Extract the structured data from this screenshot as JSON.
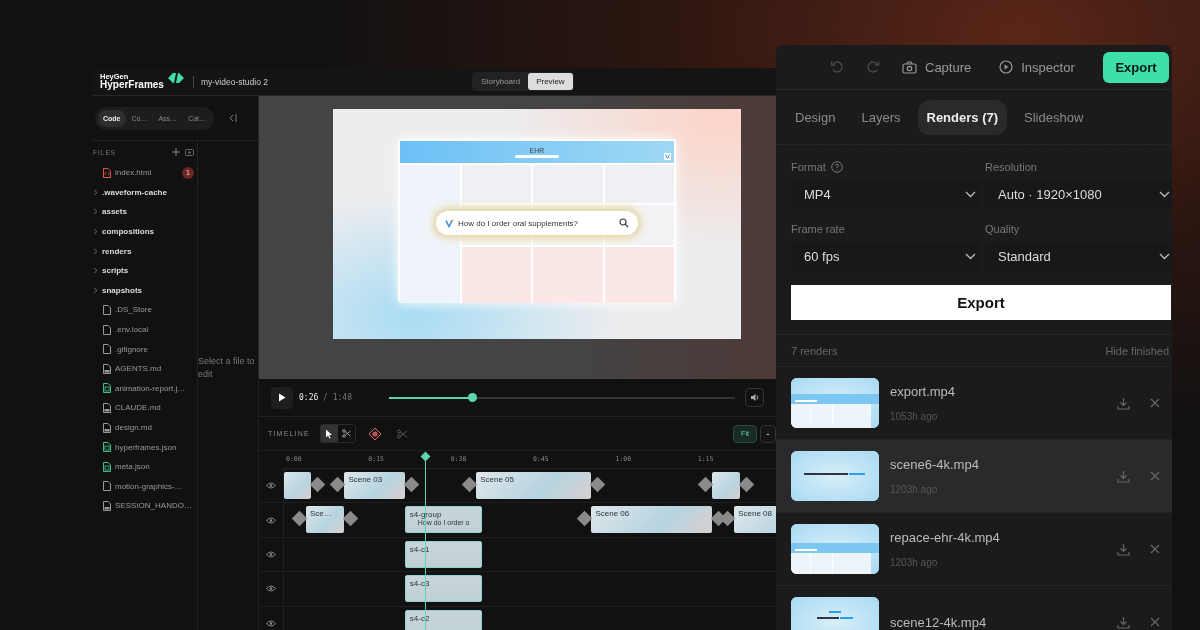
{
  "app": {
    "logo_top": "HeyGen",
    "logo_bottom": "HyperFrames",
    "project": "my-video-studio 2"
  },
  "view_switch": [
    {
      "label": "Storyboard",
      "selected": false
    },
    {
      "label": "Preview",
      "selected": true
    }
  ],
  "sidebar": {
    "tabs": [
      {
        "label": "Code",
        "selected": true
      },
      {
        "label": "Co…",
        "selected": false
      },
      {
        "label": "Ass…",
        "selected": false
      },
      {
        "label": "Cat…",
        "selected": false
      }
    ],
    "files_header": "FILES",
    "files": [
      {
        "name": "index.html",
        "kind": "html",
        "badge": "1"
      },
      {
        "name": ".waveform-cache",
        "kind": "folder"
      },
      {
        "name": "assets",
        "kind": "folder"
      },
      {
        "name": "compositions",
        "kind": "folder"
      },
      {
        "name": "renders",
        "kind": "folder"
      },
      {
        "name": "scripts",
        "kind": "folder"
      },
      {
        "name": "snapshots",
        "kind": "folder"
      },
      {
        "name": ".DS_Store",
        "kind": "file"
      },
      {
        "name": ".env.local",
        "kind": "file"
      },
      {
        "name": ".gitignore",
        "kind": "file"
      },
      {
        "name": "AGENTS.md",
        "kind": "markdown"
      },
      {
        "name": "animation-report.j…",
        "kind": "json"
      },
      {
        "name": "CLAUDE.md",
        "kind": "markdown"
      },
      {
        "name": "design.md",
        "kind": "markdown"
      },
      {
        "name": "hyperframes.json",
        "kind": "json"
      },
      {
        "name": "meta.json",
        "kind": "json"
      },
      {
        "name": "motion-graphics-…",
        "kind": "file"
      },
      {
        "name": "SESSION_HANDO…",
        "kind": "markdown"
      }
    ],
    "editor_hint": "Select a file to edit"
  },
  "preview": {
    "ehr_title": "EHR",
    "search_text": "How do I order oral supplements?"
  },
  "playback": {
    "current": "0:26",
    "separator": "/",
    "total": "1:48",
    "level": 0.24
  },
  "timeline": {
    "title": "TIMELINE",
    "tools": [
      {
        "kind": "select",
        "selected": true
      },
      {
        "kind": "cut",
        "selected": false
      }
    ],
    "fit": "Fit",
    "zoom_out": "-",
    "ticks": [
      "0:00",
      "0:15",
      "0:30",
      "0:45",
      "1:00",
      "1:15"
    ],
    "tracks": [
      {
        "clips": [
          {
            "transitions": true
          },
          {
            "label": "Scene 03",
            "transitions": true
          },
          {
            "label": "Scene 05",
            "transitions": true
          },
          {
            "transitions": true
          }
        ]
      },
      {
        "clips": [
          {
            "label": "Sce…",
            "transitions": true
          },
          {
            "label": "s4-group",
            "caption": "How do I order o",
            "transitions": false
          },
          {
            "label": "Scene 06",
            "transitions": true
          },
          {
            "label": "Scene 08",
            "transitions": true
          }
        ]
      },
      {
        "clips": [
          {
            "label": "s4-c1",
            "transitions": false
          }
        ]
      },
      {
        "clips": [
          {
            "label": "s4-c3",
            "transitions": false
          }
        ]
      },
      {
        "clips": [
          {
            "label": "s4-c2",
            "transitions": false
          }
        ]
      }
    ]
  },
  "inspector": {
    "toolbar": [
      {
        "kind": "undo",
        "disabled": true
      },
      {
        "kind": "redo",
        "disabled": true
      },
      {
        "kind": "capture",
        "label": "Capture",
        "disabled": false
      },
      {
        "kind": "inspector",
        "label": "Inspector",
        "disabled": false
      }
    ],
    "export_label": "Export",
    "tabs": [
      {
        "label": "Design",
        "selected": false
      },
      {
        "label": "Layers",
        "selected": false
      },
      {
        "label": "Renders (7)",
        "selected": true
      },
      {
        "label": "Slideshow",
        "selected": false
      }
    ],
    "fields": [
      {
        "label": "Format",
        "help": true,
        "value": "MP4"
      },
      {
        "label": "Resolution",
        "help": false,
        "value": "Auto · 1920×1080"
      },
      {
        "label": "Frame rate",
        "help": false,
        "value": "60 fps"
      },
      {
        "label": "Quality",
        "help": false,
        "value": "Standard"
      }
    ],
    "export_button": "Export",
    "renders_count": "7 renders",
    "hide_finished": "Hide finished",
    "renders": [
      {
        "name": "export.mp4",
        "time": "1053h ago",
        "highlighted": false
      },
      {
        "name": "scene6-4k.mp4",
        "time": "1203h ago",
        "highlighted": true
      },
      {
        "name": "repace-ehr-4k.mp4",
        "time": "1203h ago",
        "highlighted": false
      },
      {
        "name": "scene12-4k.mp4",
        "highlighted": false
      }
    ]
  }
}
